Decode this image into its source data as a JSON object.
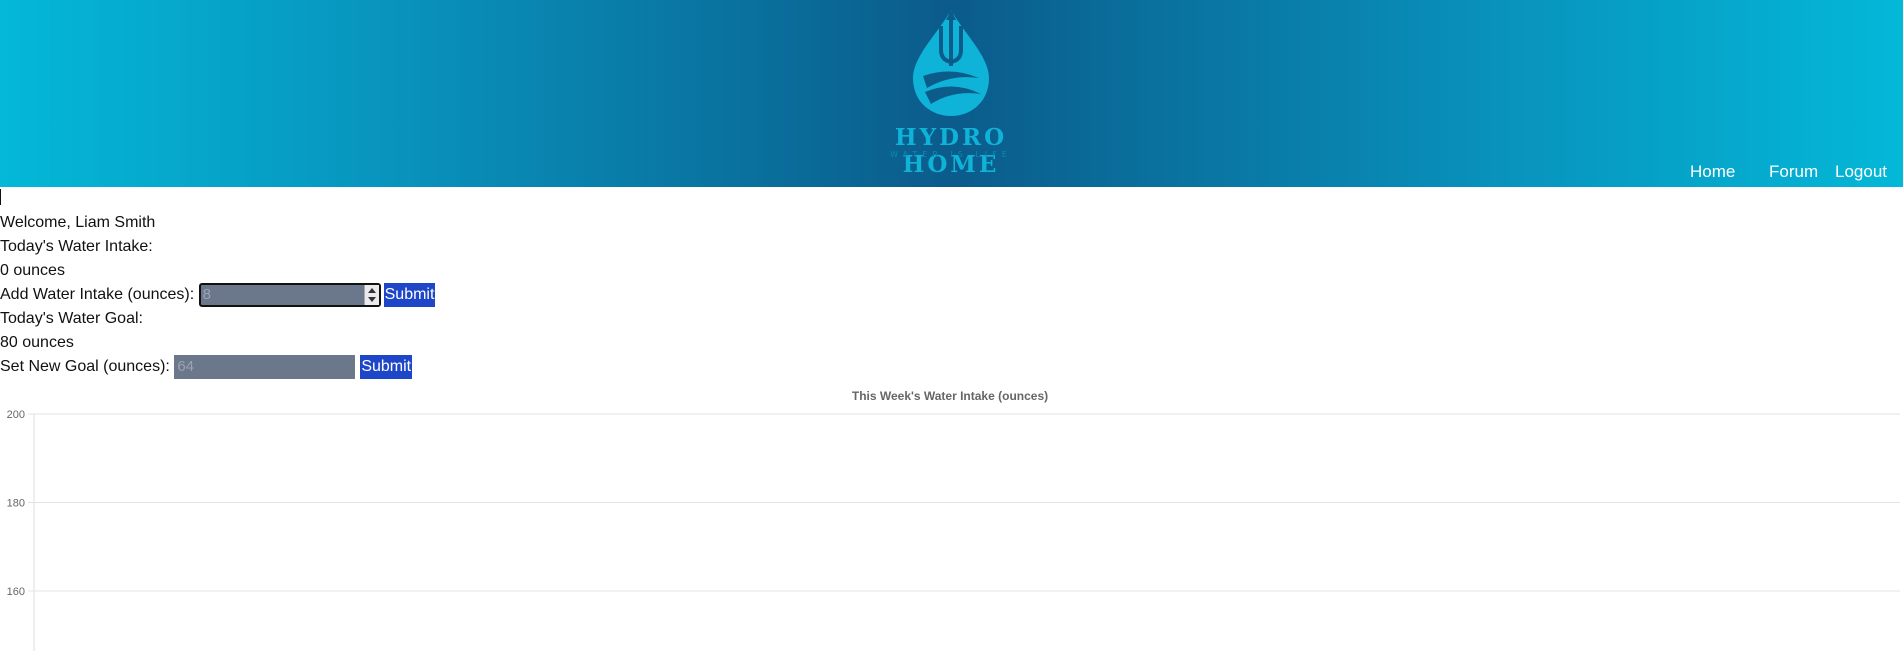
{
  "header": {
    "brand": "HYDRO HOME",
    "tagline": "WATER IS LIFE",
    "nav": [
      {
        "label": "Home"
      },
      {
        "label": "Forum"
      },
      {
        "label": "Logout"
      }
    ],
    "colors": {
      "gradient_edge": "#04b8d8",
      "gradient_center": "#0b5b8b",
      "logo": "#0fb3d8"
    }
  },
  "main": {
    "welcome": "Welcome, Liam Smith",
    "intake_label": "Today's Water Intake:",
    "intake_value": "0 ounces",
    "add_label": "Add Water Intake (ounces):",
    "add_placeholder": "8",
    "add_submit": "Submit",
    "goal_label": "Today's Water Goal:",
    "goal_value": "80 ounces",
    "set_goal_label": "Set New Goal (ounces):",
    "set_goal_placeholder": "64",
    "set_goal_submit": "Submit",
    "colors": {
      "input_bg": "#6b778b",
      "button_bg": "#1d47c8"
    }
  },
  "chart_data": {
    "type": "line",
    "title": "This Week's Water Intake (ounces)",
    "xlabel": "",
    "ylabel": "",
    "yticks": [
      200,
      180,
      160
    ],
    "ylim": [
      160,
      200
    ],
    "grid": true
  }
}
